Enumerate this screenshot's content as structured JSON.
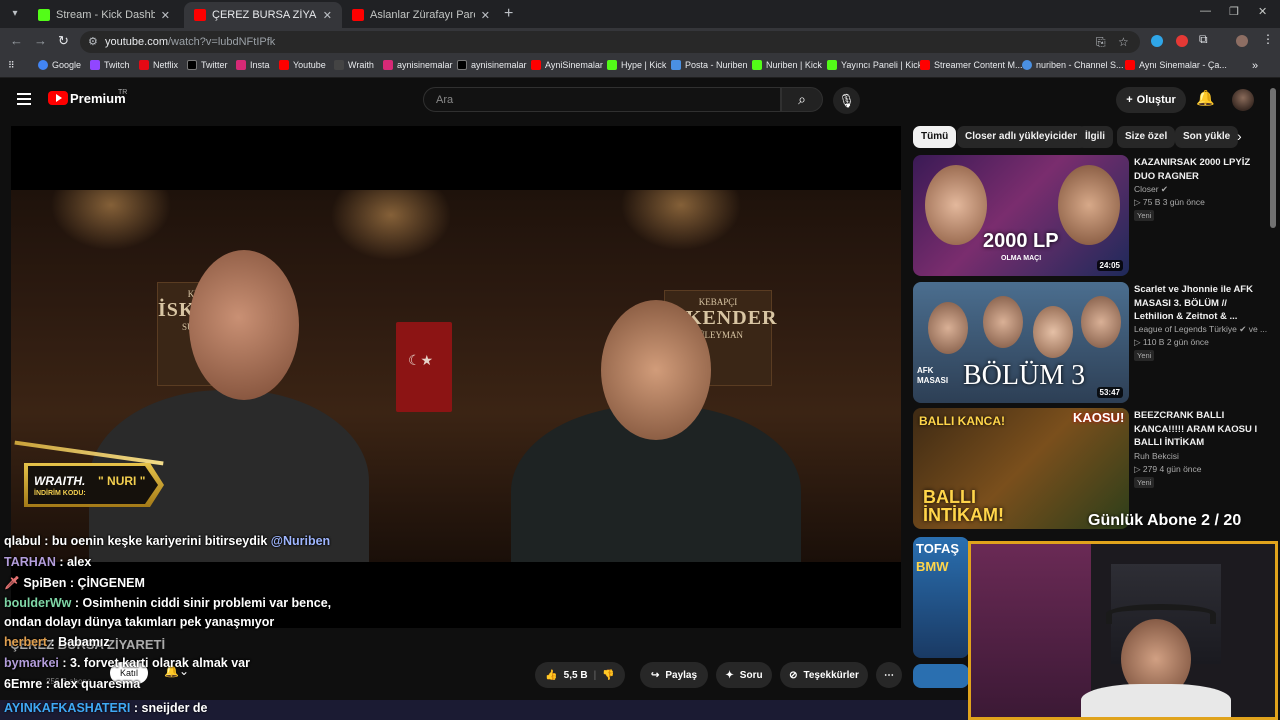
{
  "browser": {
    "tabs": [
      {
        "label": "Stream - Kick Dashboard",
        "active": false,
        "color": "#53fc18"
      },
      {
        "label": "ÇEREZ BURSA ZİYARETİ - YouTube",
        "active": true,
        "color": "#ff0000"
      },
      {
        "label": "Aslanlar Zürafayı Parçaladı! | An",
        "active": false,
        "color": "#ff0000"
      }
    ],
    "url_main": "youtube.com",
    "url_rest": "/watch?v=lubdNFtIPfk",
    "bookmarks": [
      "Google",
      "Twitch",
      "Netflix",
      "Twitter",
      "Insta",
      "Youtube",
      "Wraith",
      "aynisinemalar",
      "aynisinemalar",
      "AyniSinemalar",
      "Hype | Kick",
      "Posta - Nuriben",
      "Nuriben | Kick",
      "Yayıncı Paneli | Kick",
      "Streamer Content M...",
      "nuriben - Channel S...",
      "Aynı Sinemalar - Ça..."
    ]
  },
  "youtube": {
    "logo_text": "Premium",
    "region": "TR",
    "search_placeholder": "Ara",
    "create_label": "Oluştur"
  },
  "video": {
    "brand": "WRAITH.",
    "code": "\" NURI \"",
    "code_label": "İNDİRİM KODU:"
  },
  "chat": [
    {
      "user": "qlabul",
      "text": " : bu oenin keşke kariyerini bitirseydik ",
      "mention": "@Nuriben",
      "color": "#ffffff"
    },
    {
      "user": "TARHAN",
      "text": " : alex",
      "color": "#b39ddb"
    },
    {
      "user": "SpiBen",
      "text": " : ÇİNGENEM",
      "color": "#ffffff"
    },
    {
      "user": "boulderWw",
      "text": " : Osimhenin ciddi sinir problemi var bence, ondan dolayı dünya takımları pek yanaşmıyor",
      "color": "#7fd6a6"
    },
    {
      "user": "herbert",
      "text": " : Babamız",
      "color": "#e0a050"
    },
    {
      "user": "bymarkei",
      "text": " : 3. forvet karti olarak almak var",
      "color": "#b39ddb"
    },
    {
      "user": "6Emre",
      "text": " : alex quaresma",
      "color": "#ffffff"
    }
  ],
  "under_video": {
    "title_ghost": "ÇEREZ BURSA ZİYARETİ",
    "subs": "256 B abone",
    "join": "Katıl",
    "likes": "5,5 B",
    "share": "Paylaş",
    "ask": "Soru",
    "thanks": "Teşekkürler"
  },
  "chips": [
    "Tümü",
    "Closer adlı yükleyiciden",
    "İlgili",
    "Size özel",
    "Son yükle"
  ],
  "recommendations": [
    {
      "title": "KAZANIRSAK 2000 LPYİZ DUO RAGNER",
      "channel": "Closer ✔",
      "meta": "▷ 75 B   3 gün önce",
      "badge": "Yeni",
      "duration": "24:05",
      "thumb_text": "2000 LP",
      "thumb_sub": "OLMA MAÇI"
    },
    {
      "title": "Scarlet ve Jhonnie ile AFK MASASI 3. BÖLÜM // Lethilion & Zeitnot & ...",
      "channel": "League of Legends Türkiye ✔ ve ...",
      "meta": "▷ 110 B   2 gün önce",
      "badge": "Yeni",
      "duration": "53:47",
      "thumb_text": "BÖLÜM 3",
      "thumb_sub": "AFK MASASI"
    },
    {
      "title": "BEEZCRANK BALLI KANCA!!!!! ARAM KAOSU I BALLI İNTİKAM",
      "channel": "Ruh Bekcisi",
      "meta": "▷ 279   4 gün önce",
      "badge": "Yeni",
      "duration": "",
      "thumb_text": "BALLI İNTİKAM!",
      "thumb_sub": "BALLI KANCA!"
    },
    {
      "title": "",
      "channel": "",
      "meta": "",
      "badge": "",
      "duration": "",
      "thumb_text": "TOFAŞ",
      "thumb_sub": "BMW"
    }
  ],
  "overlay": {
    "sub_counter": "Günlük Abone 2 / 20",
    "taskbar_line_user": "AYINKAFKASHATERI",
    "taskbar_line_text": " : sneijder de"
  }
}
